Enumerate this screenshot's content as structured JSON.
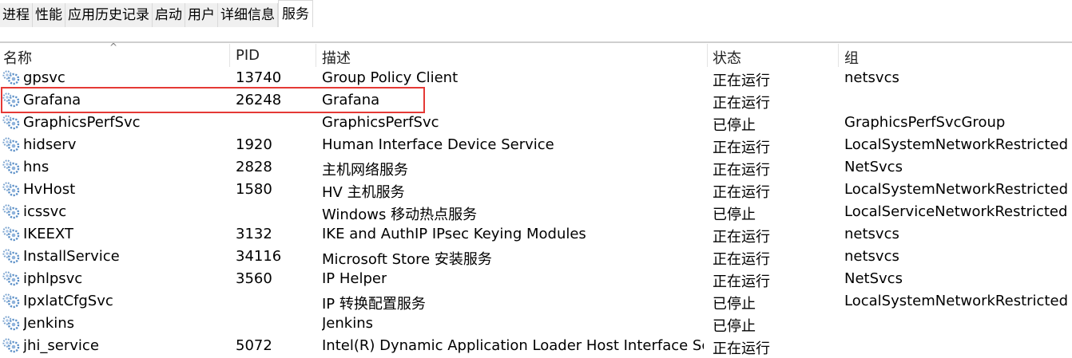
{
  "tabs": [
    {
      "label": "进程"
    },
    {
      "label": "性能"
    },
    {
      "label": "应用历史记录"
    },
    {
      "label": "启动"
    },
    {
      "label": "用户"
    },
    {
      "label": "详细信息"
    },
    {
      "label": "服务",
      "active": true
    }
  ],
  "columns": {
    "name": "名称",
    "pid": "PID",
    "desc": "描述",
    "status": "状态",
    "group": "组"
  },
  "sort_indicator": "^",
  "rows": [
    {
      "name": "gpsvc",
      "pid": "13740",
      "desc": "Group Policy Client",
      "status": "正在运行",
      "group": "netsvcs"
    },
    {
      "name": "Grafana",
      "pid": "26248",
      "desc": "Grafana",
      "status": "正在运行",
      "group": ""
    },
    {
      "name": "GraphicsPerfSvc",
      "pid": "",
      "desc": "GraphicsPerfSvc",
      "status": "已停止",
      "group": "GraphicsPerfSvcGroup"
    },
    {
      "name": "hidserv",
      "pid": "1920",
      "desc": "Human Interface Device Service",
      "status": "正在运行",
      "group": "LocalSystemNetworkRestricted"
    },
    {
      "name": "hns",
      "pid": "2828",
      "desc": "主机网络服务",
      "status": "正在运行",
      "group": "NetSvcs"
    },
    {
      "name": "HvHost",
      "pid": "1580",
      "desc": "HV 主机服务",
      "status": "正在运行",
      "group": "LocalSystemNetworkRestricted"
    },
    {
      "name": "icssvc",
      "pid": "",
      "desc": "Windows 移动热点服务",
      "status": "已停止",
      "group": "LocalServiceNetworkRestricted"
    },
    {
      "name": "IKEEXT",
      "pid": "3132",
      "desc": "IKE and AuthIP IPsec Keying Modules",
      "status": "正在运行",
      "group": "netsvcs"
    },
    {
      "name": "InstallService",
      "pid": "34116",
      "desc": "Microsoft Store 安装服务",
      "status": "正在运行",
      "group": "netsvcs"
    },
    {
      "name": "iphlpsvc",
      "pid": "3560",
      "desc": "IP Helper",
      "status": "正在运行",
      "group": "NetSvcs"
    },
    {
      "name": "IpxlatCfgSvc",
      "pid": "",
      "desc": "IP 转换配置服务",
      "status": "已停止",
      "group": "LocalSystemNetworkRestricted"
    },
    {
      "name": "Jenkins",
      "pid": "",
      "desc": "Jenkins",
      "status": "已停止",
      "group": ""
    },
    {
      "name": "jhi_service",
      "pid": "5072",
      "desc": "Intel(R) Dynamic Application Loader Host Interface Se...",
      "status": "正在运行",
      "group": ""
    }
  ],
  "colors": {
    "highlight": "#e53935",
    "icon": "#5b8fc7"
  }
}
